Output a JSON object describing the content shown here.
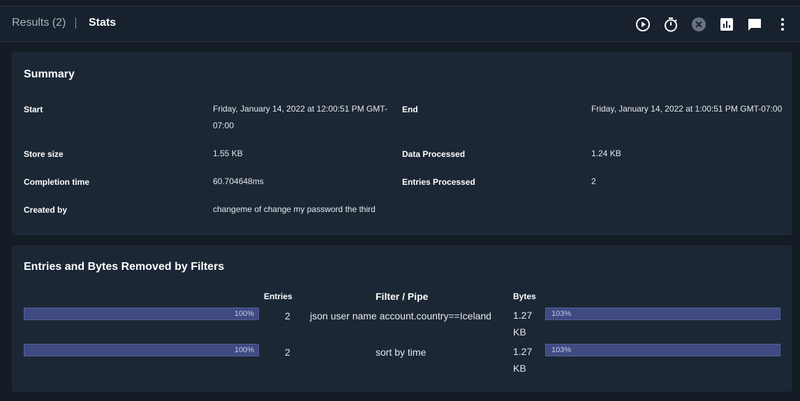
{
  "toolbar": {
    "results_tab": "Results (2)",
    "stats_tab": "Stats",
    "icons": [
      "play-icon",
      "timer-icon",
      "cancel-icon",
      "chart-icon",
      "comment-icon",
      "more-vert-icon"
    ]
  },
  "summary": {
    "title": "Summary",
    "start_label": "Start",
    "start_value_line1": "Friday, January 14, 2022 at 12:00:51 PM GMT-",
    "start_value_line2": "07:00",
    "end_label": "End",
    "end_value": "Friday, January 14, 2022 at 1:00:51 PM GMT-07:00",
    "store_size_label": "Store size",
    "store_size_value": "1.55 KB",
    "data_processed_label": "Data Processed",
    "data_processed_value": "1.24 KB",
    "completion_time_label": "Completion time",
    "completion_time_value": "60.704648ms",
    "entries_processed_label": "Entries Processed",
    "entries_processed_value": "2",
    "created_by_label": "Created by",
    "created_by_value": "changeme of change my password the third"
  },
  "filters": {
    "title": "Entries and Bytes Removed by Filters",
    "headers": {
      "entries": "Entries",
      "filter": "Filter / Pipe",
      "bytes": "Bytes"
    },
    "rows": [
      {
        "entries_pct": "100%",
        "entries": "2",
        "filter": "json user name account.country==Iceland",
        "bytes_line1": "1.27",
        "bytes_line2": "KB",
        "bytes_pct": "103%"
      },
      {
        "entries_pct": "100%",
        "entries": "2",
        "filter": "sort by time",
        "bytes_line1": "1.27",
        "bytes_line2": "KB",
        "bytes_pct": "103%"
      }
    ]
  },
  "colors": {
    "background": "#141c26",
    "card": "#1c2735",
    "bar": "#3f4a82"
  }
}
